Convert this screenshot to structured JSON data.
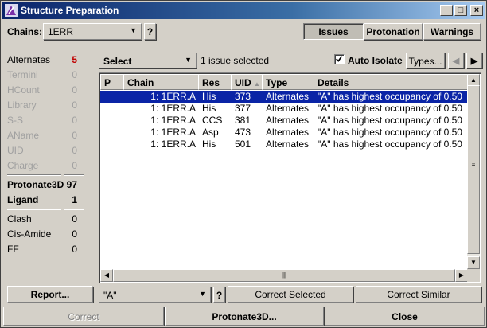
{
  "window": {
    "title": "Structure Preparation"
  },
  "header": {
    "chains_label": "Chains:",
    "chains_value": "1ERR",
    "help": "?",
    "tabs": [
      {
        "label": "Issues",
        "active": true
      },
      {
        "label": "Protonation",
        "active": false
      },
      {
        "label": "Warnings",
        "active": false
      }
    ]
  },
  "left_panel": {
    "groups": [
      [
        {
          "name": "Alternates",
          "count": "5",
          "active": true,
          "color": "#c00000"
        },
        {
          "name": "Termini",
          "count": "0",
          "active": false
        },
        {
          "name": "HCount",
          "count": "0",
          "active": false
        },
        {
          "name": "Library",
          "count": "0",
          "active": false
        },
        {
          "name": "S-S",
          "count": "0",
          "active": false
        },
        {
          "name": "AName",
          "count": "0",
          "active": false
        },
        {
          "name": "UID",
          "count": "0",
          "active": false
        },
        {
          "name": "Charge",
          "count": "0",
          "active": false
        }
      ],
      [
        {
          "name": "Protonate3D",
          "count": "97",
          "active": true,
          "bold": true
        },
        {
          "name": "Ligand",
          "count": "1",
          "active": true,
          "bold": true
        }
      ],
      [
        {
          "name": "Clash",
          "count": "0",
          "active": true
        },
        {
          "name": "Cis-Amide",
          "count": "0",
          "active": true
        },
        {
          "name": "FF",
          "count": "0",
          "active": true
        }
      ]
    ],
    "report_button": "Report..."
  },
  "toolbar": {
    "select_value": "Select",
    "status": "1 issue selected",
    "auto_isolate_label": "Auto Isolate",
    "auto_isolate_checked": true,
    "types_button": "Types..."
  },
  "table": {
    "columns": [
      "P",
      "Chain",
      "Res",
      "UID",
      "Type",
      "Details"
    ],
    "rows": [
      {
        "p": "",
        "chain": "1: 1ERR.A",
        "res": "His",
        "uid": "373",
        "type": "Alternates",
        "details": "\"A\" has highest occupancy of 0.50",
        "selected": true
      },
      {
        "p": "",
        "chain": "1: 1ERR.A",
        "res": "His",
        "uid": "377",
        "type": "Alternates",
        "details": "\"A\" has highest occupancy of 0.50",
        "selected": false
      },
      {
        "p": "",
        "chain": "1: 1ERR.A",
        "res": "CCS",
        "uid": "381",
        "type": "Alternates",
        "details": "\"A\" has highest occupancy of 0.50",
        "selected": false
      },
      {
        "p": "",
        "chain": "1: 1ERR.A",
        "res": "Asp",
        "uid": "473",
        "type": "Alternates",
        "details": "\"A\" has highest occupancy of 0.50",
        "selected": false
      },
      {
        "p": "",
        "chain": "1: 1ERR.A",
        "res": "His",
        "uid": "501",
        "type": "Alternates",
        "details": "\"A\" has highest occupancy of 0.50",
        "selected": false
      }
    ]
  },
  "bottom_bar": {
    "alt_value": "\"A\"",
    "help": "?",
    "correct_selected": "Correct Selected",
    "correct_similar": "Correct Similar"
  },
  "footer": {
    "correct": "Correct",
    "protonate": "Protonate3D...",
    "close": "Close"
  }
}
